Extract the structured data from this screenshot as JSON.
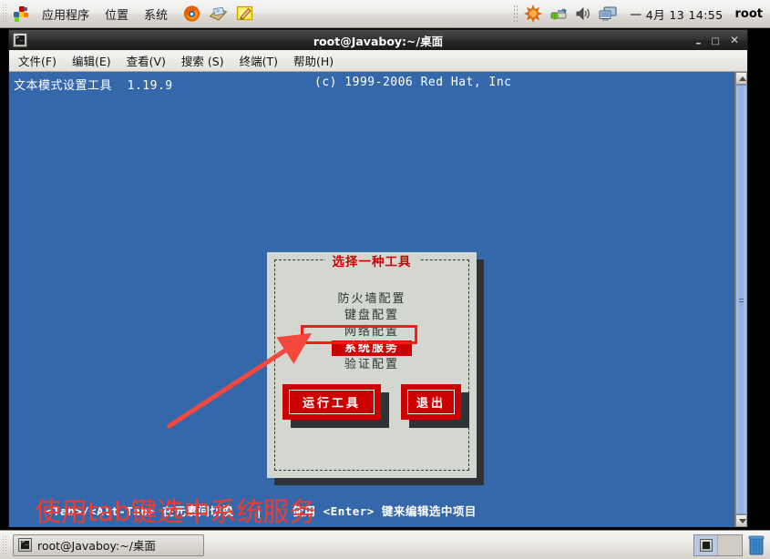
{
  "colors": {
    "terminal_bg": "#3568ab",
    "dialog_bg": "#d3d7cf",
    "dialog_shadow": "#2e3436",
    "accent_red": "#cc0000",
    "annotation_red": "#f03b30",
    "panel_bg": "#ececea",
    "titlebar_bg": "#262626"
  },
  "top_panel": {
    "menus": [
      {
        "label": "应用程序",
        "icon": "applications-menu-icon"
      },
      {
        "label": "位置",
        "icon": "places-menu-icon"
      },
      {
        "label": "系统",
        "icon": "system-menu-icon"
      }
    ],
    "launchers": [
      {
        "name": "firefox-launcher-icon"
      },
      {
        "name": "evolution-mail-launcher-icon"
      },
      {
        "name": "text-editor-launcher-icon"
      }
    ],
    "tray": [
      {
        "name": "software-update-icon"
      },
      {
        "name": "network-manager-icon"
      },
      {
        "name": "volume-icon"
      },
      {
        "name": "display-icon"
      }
    ],
    "clock": "一 4月 13 14:55",
    "user": "root"
  },
  "window": {
    "title": "root@Javaboy:~/桌面",
    "icon": "terminal-icon",
    "controls": {
      "minimize": "–",
      "maximize": "□",
      "close": "✕"
    },
    "menubar": [
      "文件(F)",
      "编辑(E)",
      "查看(V)",
      "搜索 (S)",
      "终端(T)",
      "帮助(H)"
    ]
  },
  "terminal": {
    "header_left": "文本模式设置工具  1.19.9",
    "header_right": "(c) 1999-2006 Red Hat, Inc",
    "footer": "<Tab>/<Alt-Tab> 在元素间切换   |    使用 <Enter> 键来编辑选中项目"
  },
  "dialog": {
    "title": "选择一种工具",
    "items": [
      {
        "label": "防火墙配置",
        "selected": false
      },
      {
        "label": "键盘配置",
        "selected": false
      },
      {
        "label": "网络配置",
        "selected": false
      },
      {
        "label": "系统服务",
        "selected": true
      },
      {
        "label": "验证配置",
        "selected": false
      }
    ],
    "buttons": [
      {
        "label": "运行工具",
        "name": "run-tool-button"
      },
      {
        "label": "退出",
        "name": "quit-button"
      }
    ]
  },
  "annotation": {
    "text": "使用tab键选中系统服务",
    "arrow": "red-arrow-pointing-to-selected-item"
  },
  "scrollbar": {
    "up_arrow": "scroll-up-arrow",
    "down_arrow": "scroll-down-arrow",
    "thumb": "scroll-thumb"
  },
  "bottom_panel": {
    "task_button": {
      "label": "root@Javaboy:~/桌面",
      "icon": "terminal-icon"
    },
    "workspaces": [
      {
        "name": "workspace-1",
        "active": true
      },
      {
        "name": "workspace-2",
        "active": false
      }
    ],
    "trash": {
      "name": "trash-icon"
    }
  }
}
